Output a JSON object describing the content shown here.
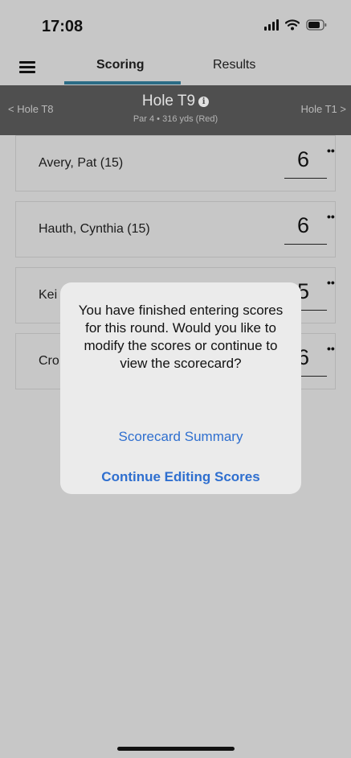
{
  "status": {
    "time": "17:08"
  },
  "nav": {
    "tabs": [
      {
        "label": "Scoring"
      },
      {
        "label": "Results"
      }
    ]
  },
  "hole": {
    "prev": "< Hole T8",
    "title": "Hole T9",
    "info": "i",
    "subtitle": "Par 4 • 316 yds (Red)",
    "next": "Hole T1 >"
  },
  "players": [
    {
      "name": "Avery, Pat (15)",
      "score": "6"
    },
    {
      "name": "Hauth, Cynthia (15)",
      "score": "6"
    },
    {
      "name": "Kei",
      "score": "5"
    },
    {
      "name": "Cro",
      "score": "6"
    }
  ],
  "more_glyph": "••",
  "alert": {
    "message": "You have finished entering scores for this round. Would you like to modify the scores or continue to view the scorecard?",
    "summary_label": "Scorecard Summary",
    "continue_label": "Continue Editing Scores"
  },
  "colors": {
    "accent": "#2b6c86",
    "link": "#2f6fcf",
    "header": "#4f4f4f"
  }
}
